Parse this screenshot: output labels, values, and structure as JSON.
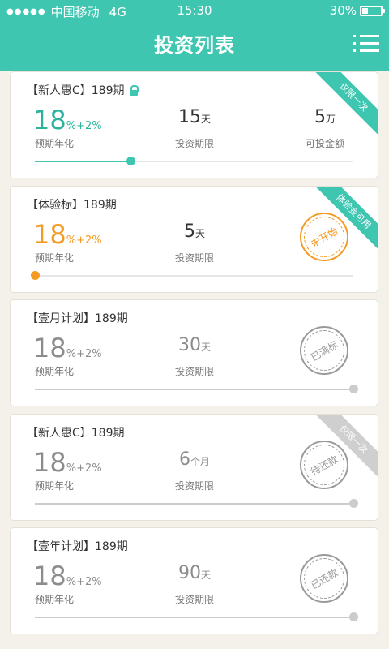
{
  "status": {
    "signal": "●●●●●",
    "carrier": "中国移动",
    "network": "4G",
    "time": "15:30",
    "battery": "30%",
    "battery_level": 0.3
  },
  "header": {
    "title": "投资列表",
    "menu_icon": "menu-list-icon"
  },
  "colors": {
    "brand": "#3ec6b0",
    "green_text": "#2cb39c",
    "orange": "#f59a23",
    "gray": "#999999"
  },
  "cards": [
    {
      "name": "【新人惠C】189期",
      "locked": true,
      "rate_base": "18",
      "rate_suffix": "%+2%",
      "rate_label": "预期年化",
      "term_num": "15",
      "term_unit": "天",
      "term_label": "投资期限",
      "amount_num": "5",
      "amount_unit": "万",
      "amount_label": "可投金额",
      "progress": 0.3,
      "ribbon": "仅限一次"
    },
    {
      "name": "【体验标】189期",
      "rate_base": "18",
      "rate_suffix": "%+2%",
      "rate_label": "预期年化",
      "term_num": "5",
      "term_unit": "天",
      "term_label": "投资期限",
      "progress": 0.0,
      "ribbon": "体验金可用",
      "stamp": "未开始"
    },
    {
      "name": "【壹月计划】189期",
      "rate_base": "18",
      "rate_suffix": "%+2%",
      "rate_label": "预期年化",
      "term_num": "30",
      "term_unit": "天",
      "term_label": "投资期限",
      "progress": 1.0,
      "stamp": "已满标"
    },
    {
      "name": "【新人惠C】189期",
      "rate_base": "18",
      "rate_suffix": "%+2%",
      "rate_label": "预期年化",
      "term_num": "6",
      "term_unit": "个月",
      "term_label": "投资期限",
      "progress": 1.0,
      "ribbon": "仅限一次",
      "stamp": "待还款"
    },
    {
      "name": "【壹年计划】189期",
      "rate_base": "18",
      "rate_suffix": "%+2%",
      "rate_label": "预期年化",
      "term_num": "90",
      "term_unit": "天",
      "term_label": "投资期限",
      "progress": 1.0,
      "stamp": "已还款"
    }
  ]
}
